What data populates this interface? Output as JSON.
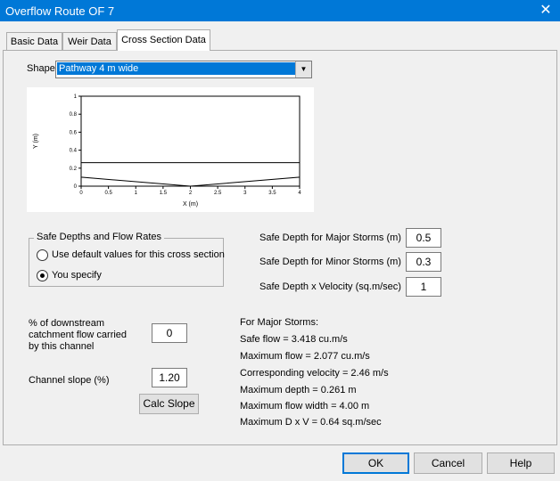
{
  "window": {
    "title": "Overflow Route OF 7",
    "close_glyph": "✕"
  },
  "tabs": [
    {
      "label": "Basic Data"
    },
    {
      "label": "Weir Data"
    },
    {
      "label": "Cross Section Data"
    }
  ],
  "shape": {
    "label": "Shape",
    "selected": "Pathway 4 m wide",
    "arrow": "▼"
  },
  "chart_data": {
    "type": "line",
    "xlabel": "X (m)",
    "ylabel": "Y (m)",
    "xlim": [
      0,
      4
    ],
    "ylim": [
      0,
      1
    ],
    "x_ticks": [
      "0",
      "0.5",
      "1",
      "1.5",
      "2",
      "2.5",
      "3",
      "3.5",
      "4"
    ],
    "y_ticks": [
      "0",
      "0.2",
      "0.4",
      "0.6",
      "0.8",
      "1"
    ],
    "series": [
      {
        "x": [
          0,
          0,
          2,
          4,
          4
        ],
        "y": [
          1,
          0.1,
          0,
          0.1,
          1
        ]
      },
      {
        "x": [
          0,
          4
        ],
        "y": [
          0.261,
          0.261
        ]
      }
    ]
  },
  "safe_group": {
    "title": "Safe Depths and Flow Rates",
    "option_default": "Use default values for this cross section",
    "option_specify": "You specify",
    "selected": "specify"
  },
  "safe_depth": {
    "major_label": "Safe Depth for Major Storms (m)",
    "major_value": "0.5",
    "minor_label": "Safe Depth for Minor Storms (m)",
    "minor_value": "0.3",
    "dxv_label": "Safe Depth x Velocity (sq.m/sec)",
    "dxv_value": "1"
  },
  "catchment": {
    "label_line1": "% of downstream",
    "label_line2": "catchment flow carried",
    "label_line3": "by this channel",
    "value": "0"
  },
  "slope": {
    "label": "Channel slope (%)",
    "value": "1.20",
    "calc_button": "Calc Slope"
  },
  "results": {
    "heading": "For Major Storms:",
    "safe_flow": "Safe flow = 3.418 cu.m/s",
    "max_flow": "Maximum flow = 2.077 cu.m/s",
    "velocity": "Corresponding velocity = 2.46 m/s",
    "max_depth": "Maximum depth = 0.261 m",
    "max_width": "Maximum flow width = 4.00 m",
    "max_dxv": "Maximum D x V = 0.64 sq.m/sec"
  },
  "buttons": {
    "ok": "OK",
    "cancel": "Cancel",
    "help": "Help"
  },
  "colors": {
    "accent": "#0078d7",
    "chart_line": "#000000"
  }
}
